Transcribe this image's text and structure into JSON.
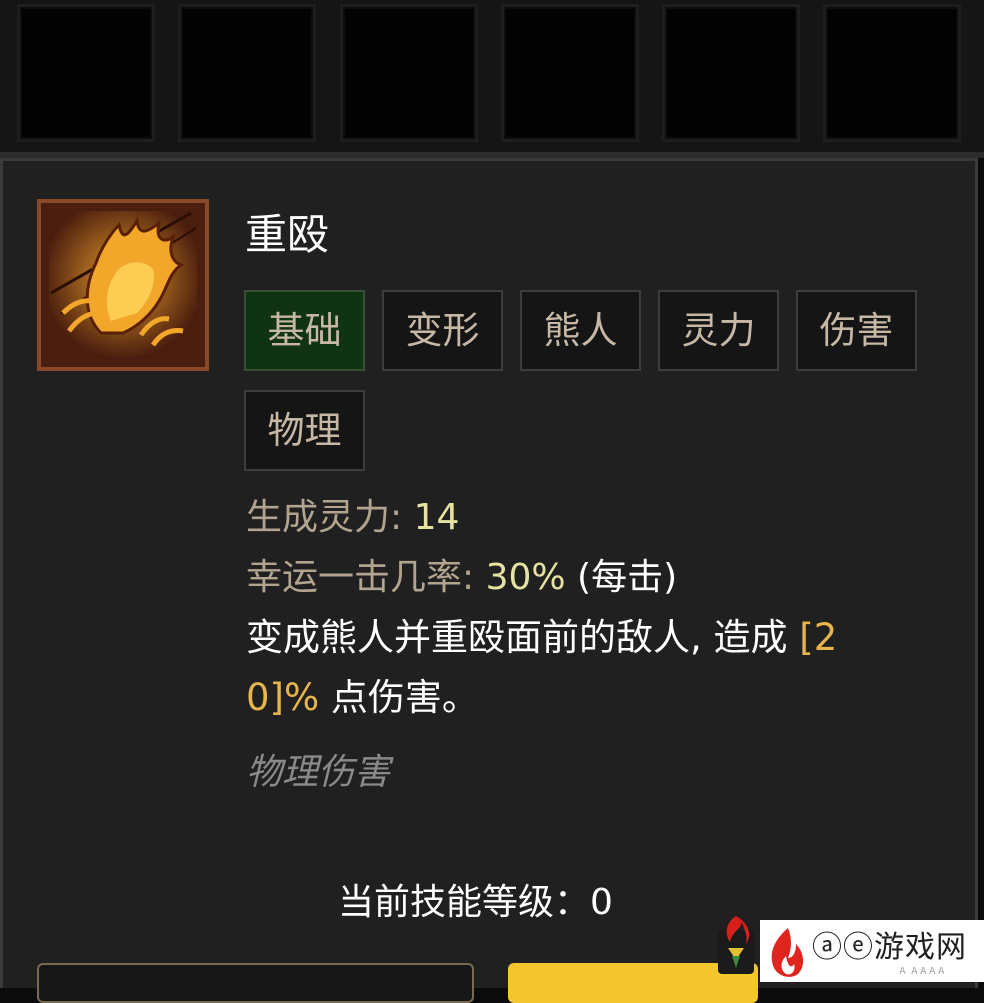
{
  "skill": {
    "name": "重殴",
    "icon": "bear-claw-icon",
    "tags": [
      "基础",
      "变形",
      "熊人",
      "灵力",
      "伤害",
      "物理"
    ],
    "stats": [
      {
        "label": "生成灵力: ",
        "value": "14",
        "suffix": ""
      },
      {
        "label": "幸运一击几率: ",
        "value": "30%",
        "suffix": " (每击)"
      }
    ],
    "description": {
      "line1": "变成熊人并重殴面前的敌人, 造成 ",
      "value_part1": "[2",
      "value_part2": "0]%",
      "line2_rest": " 点伤害。"
    },
    "damage_type": "物理伤害"
  },
  "level": {
    "label": "当前技能等级：",
    "value": "0"
  },
  "watermark": {
    "text": "ⓐⓔ游戏网",
    "small": "Ａ  ＡＡＡＡ"
  },
  "colors": {
    "panel_bg": "#202020",
    "tag_active_bg": "#103313",
    "highlight": "#e8b54a",
    "stat_value": "#e6e2a0",
    "button_yellow": "#f2c62c"
  }
}
